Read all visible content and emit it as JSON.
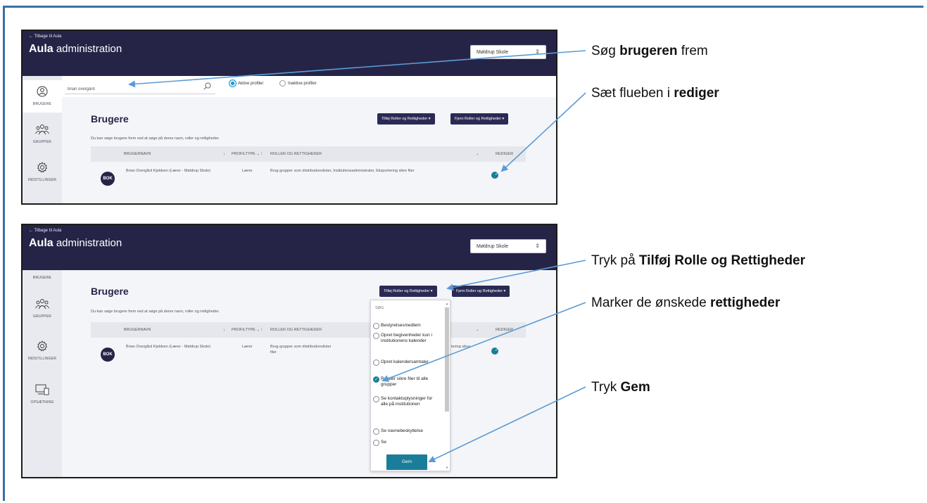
{
  "common": {
    "back_link": "← Tilbage til Aula",
    "brand_bold": "Aula",
    "brand_rest": " administration",
    "school": "Møldrup Skole",
    "page_title": "Brugere",
    "hint": "Du kan søge brugere frem ved at søge på deres navn, roller og rettigheder.",
    "add_button": "Tilføj Roller og Rettigheder ▾",
    "remove_button": "Fjern Roller og Rettigheder ▾"
  },
  "sidebar": {
    "users": "BRUGERE",
    "groups": "GRUPPER",
    "settings": "INDSTILLINGER",
    "setup": "OPSÆTNING"
  },
  "search": {
    "value": "brian overgård",
    "radio_active": "Aktive profiler",
    "radio_inactive": "Inaktive profiler"
  },
  "table": {
    "headers": {
      "username": "BRUGERNAVN",
      "sort": "↓",
      "profiletype": "PROFILTYPE ⌄ ⁝",
      "roles": "ROLLER OG RETTIGHEDER",
      "chevron": "⌄",
      "edit": "REDIGER"
    },
    "row": {
      "avatar": "BOK",
      "name": "Brian Overgård Kjeldsen (Lærer - Møldrup Skole)",
      "profiletype": "Lærer",
      "roles": "Brug grupper som distributionslister, Institutionsadministrator, Eksportering sikre filer",
      "roles_trunc": "Brug grupper som distributionslister",
      "roles_tail": "tering sikre",
      "roles_line2": "filer"
    }
  },
  "dropdown": {
    "search_label": "SØG",
    "items": [
      {
        "label": "Bestyrelsesmedlem",
        "checked": false
      },
      {
        "label": "Opret begivenheder kun i institutionens kalender",
        "checked": false
      },
      {
        "label": "Opret kalendersamtaler",
        "checked": false
      },
      {
        "label": "Relater sikre filer til alle grupper",
        "checked": true
      },
      {
        "label": "Se kontaktoplysninger for alle på institutionen",
        "checked": false
      },
      {
        "label": "Se navnebeskyttelse",
        "checked": false
      },
      {
        "label": "Se",
        "checked": false
      }
    ],
    "save_button": "Gem"
  },
  "callouts": {
    "c1_pre": "Søg ",
    "c1_bold": "brugeren",
    "c1_post": " frem",
    "c2_pre": "Sæt flueben i ",
    "c2_bold": "rediger",
    "c3_pre": "Tryk på ",
    "c3_bold": "Tilføj Rolle og Rettigheder",
    "c4_pre": "Marker de ønskede ",
    "c4_bold": "rettigheder",
    "c5_pre": "Tryk ",
    "c5_bold": "Gem"
  },
  "colors": {
    "header": "#252447",
    "accent": "#1a7e9a",
    "arrow": "#5b9bd5",
    "frame": "#3a6fa8"
  },
  "icons": [
    "user-circle-icon",
    "group-icon",
    "gear-icon",
    "devices-icon",
    "search-icon",
    "check-icon",
    "arrow-left-icon"
  ]
}
